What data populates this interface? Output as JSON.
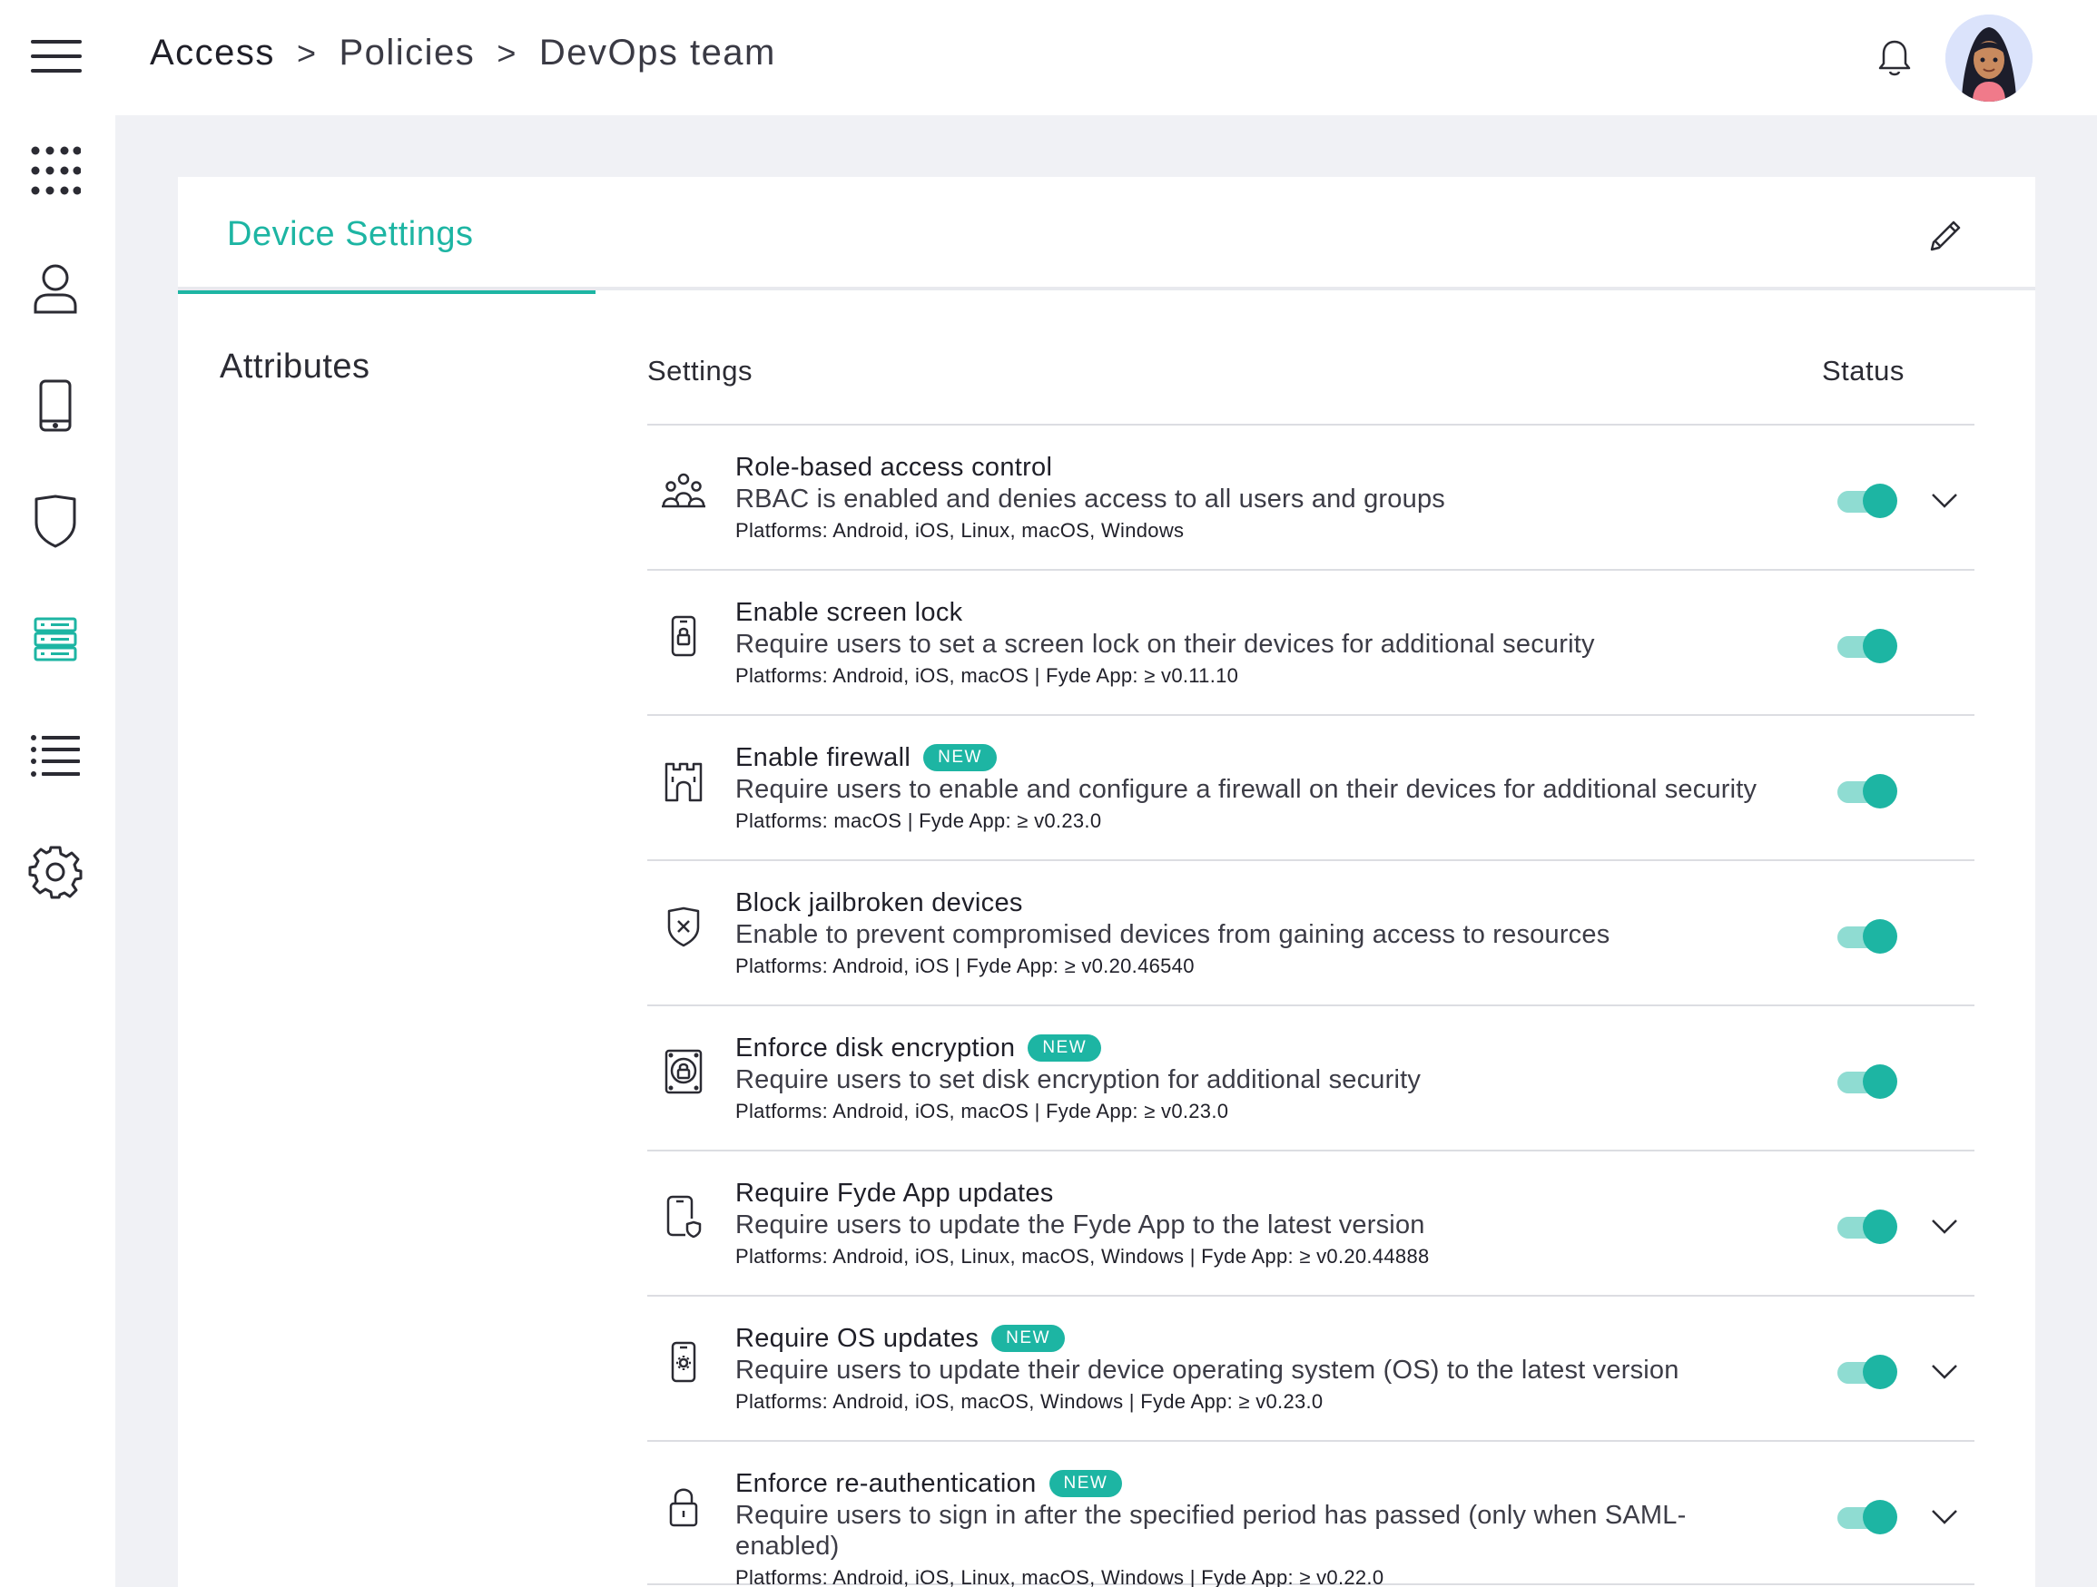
{
  "header": {
    "breadcrumb": [
      "Access",
      "Policies",
      "DevOps team"
    ],
    "breadcrumb_separator": ">"
  },
  "sidebar": {
    "items": [
      {
        "icon": "apps-grid-icon"
      },
      {
        "icon": "user-icon"
      },
      {
        "icon": "mobile-device-icon"
      },
      {
        "icon": "shield-icon"
      },
      {
        "icon": "server-icon",
        "active": true
      },
      {
        "icon": "list-icon"
      },
      {
        "icon": "gear-icon"
      }
    ]
  },
  "card": {
    "tab_label": "Device Settings",
    "section_label": "Attributes",
    "columns": {
      "settings": "Settings",
      "status": "Status"
    }
  },
  "settings": [
    {
      "title": "Role-based access control",
      "badge": "",
      "description": "RBAC is enabled and denies access to all users and groups",
      "platforms": "Platforms: Android, iOS, Linux, macOS, Windows",
      "enabled": true,
      "expandable": true,
      "icon": "users-group-icon"
    },
    {
      "title": "Enable screen lock",
      "badge": "",
      "description": "Require users to set a screen lock on their devices for additional security",
      "platforms": "Platforms: Android, iOS, macOS | Fyde App: ≥ v0.11.10",
      "enabled": true,
      "expandable": false,
      "icon": "phone-lock-icon"
    },
    {
      "title": "Enable firewall",
      "badge": "NEW",
      "description": "Require users to enable and configure a firewall on their devices for additional security",
      "platforms": "Platforms: macOS | Fyde App: ≥ v0.23.0",
      "enabled": true,
      "expandable": false,
      "icon": "firewall-icon"
    },
    {
      "title": "Block jailbroken devices",
      "badge": "",
      "description": "Enable to prevent compromised devices from gaining access to resources",
      "platforms": "Platforms: Android, iOS | Fyde App: ≥ v0.20.46540",
      "enabled": true,
      "expandable": false,
      "icon": "shield-x-icon"
    },
    {
      "title": "Enforce disk encryption",
      "badge": "NEW",
      "description": "Require users to set disk encryption for additional security",
      "platforms": "Platforms: Android, iOS, macOS | Fyde App: ≥ v0.23.0",
      "enabled": true,
      "expandable": false,
      "icon": "disk-lock-icon"
    },
    {
      "title": "Require Fyde App updates",
      "badge": "",
      "description": "Require users to update the Fyde App to the latest version",
      "platforms": "Platforms: Android, iOS, Linux, macOS, Windows | Fyde App: ≥ v0.20.44888",
      "enabled": true,
      "expandable": true,
      "icon": "phone-shield-icon"
    },
    {
      "title": "Require OS updates",
      "badge": "NEW",
      "description": "Require users to update their device operating system (OS) to the latest version",
      "platforms": "Platforms: Android, iOS, macOS, Windows | Fyde App: ≥ v0.23.0",
      "enabled": true,
      "expandable": true,
      "icon": "phone-gear-icon"
    },
    {
      "title": "Enforce re-authentication",
      "badge": "NEW",
      "description": "Require users to sign in after the specified period has passed (only when SAML-enabled)",
      "platforms": "Platforms: Android, iOS, Linux, macOS, Windows | Fyde App: ≥ v0.22.0",
      "enabled": true,
      "expandable": true,
      "icon": "padlock-icon"
    }
  ],
  "colors": {
    "accent": "#1db5a3",
    "accent_light": "#8fdcd2",
    "background": "#f0f1f5"
  }
}
